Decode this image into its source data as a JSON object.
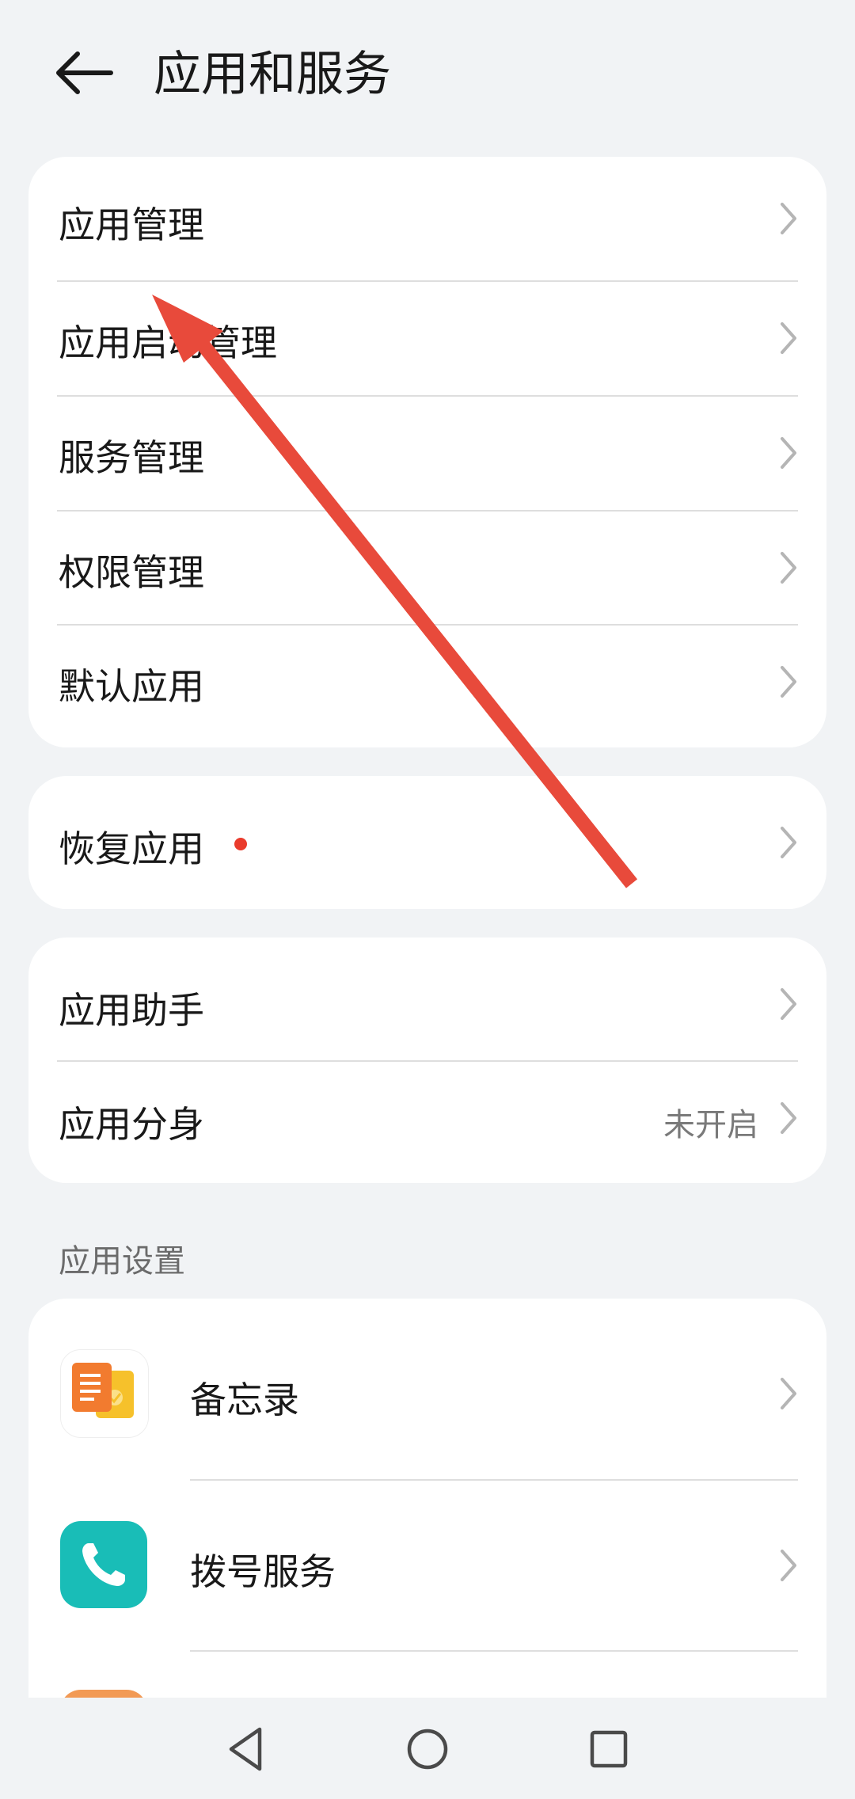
{
  "header": {
    "title": "应用和服务"
  },
  "group1": {
    "items": [
      {
        "label": "应用管理"
      },
      {
        "label": "应用启动管理"
      },
      {
        "label": "服务管理"
      },
      {
        "label": "权限管理"
      },
      {
        "label": "默认应用"
      }
    ]
  },
  "group2": {
    "items": [
      {
        "label": "恢复应用",
        "has_badge": true
      }
    ]
  },
  "group3": {
    "items": [
      {
        "label": "应用助手"
      },
      {
        "label": "应用分身",
        "value": "未开启"
      }
    ]
  },
  "app_settings": {
    "section_title": "应用设置",
    "apps": [
      {
        "label": "备忘录",
        "icon": "notes-icon"
      },
      {
        "label": "拨号服务",
        "icon": "phone-icon"
      }
    ]
  },
  "navbar": {
    "buttons": [
      "back-icon",
      "home-icon",
      "recents-icon"
    ]
  },
  "colors": {
    "background": "#f1f3f5",
    "card": "#ffffff",
    "accent_red": "#ea3b2c",
    "annotation_arrow": "#e84a3b"
  }
}
